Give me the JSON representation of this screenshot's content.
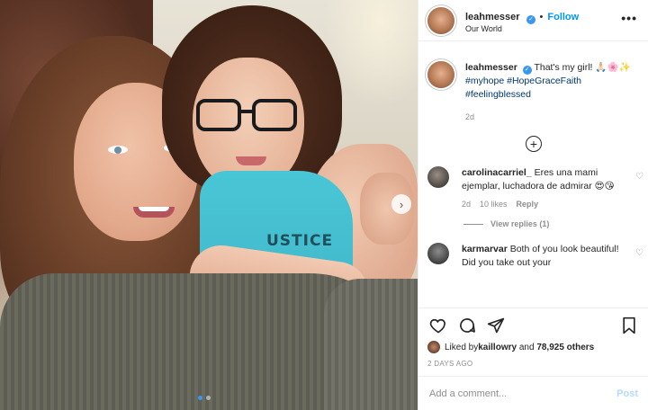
{
  "header": {
    "username": "leahmesser",
    "follow_label": "Follow",
    "location": "Our World",
    "more_glyph": "•••"
  },
  "photo": {
    "shirt_text": "USTICE",
    "next_glyph": "›",
    "carousel_count": 2,
    "carousel_active": 1
  },
  "caption": {
    "username": "leahmesser",
    "text": "That's my girl! 🙏🏻🌸✨",
    "hashtags": [
      "#myhope",
      "#HopeGraceFaith",
      "#feelingblessed"
    ],
    "time": "2d"
  },
  "load_more_glyph": "+",
  "comments": [
    {
      "username": "carolinacarriel_",
      "text": "Eres una mami ejemplar, luchadora de admirar 😍😘",
      "time": "2d",
      "likes": "10 likes",
      "reply_label": "Reply",
      "view_replies": "View replies (1)"
    },
    {
      "username": "karmarvar",
      "text": "Both of you look beautiful! Did you take out your"
    }
  ],
  "likes": {
    "prefix": "Liked by ",
    "user": "kaillowry",
    "middle": " and ",
    "count": "78,925 others"
  },
  "posted": "2 DAYS AGO",
  "add_comment": {
    "placeholder": "Add a comment...",
    "post_label": "Post"
  },
  "colors": {
    "accent": "#0095f6",
    "post_disabled": "#b3dbff",
    "muted": "#8e8e8e",
    "hashtag": "#00376b"
  },
  "icons": [
    "more-icon",
    "verified-icon",
    "chevron-right-icon",
    "add-circle-icon",
    "heart-icon",
    "comment-icon",
    "share-icon",
    "bookmark-icon"
  ]
}
